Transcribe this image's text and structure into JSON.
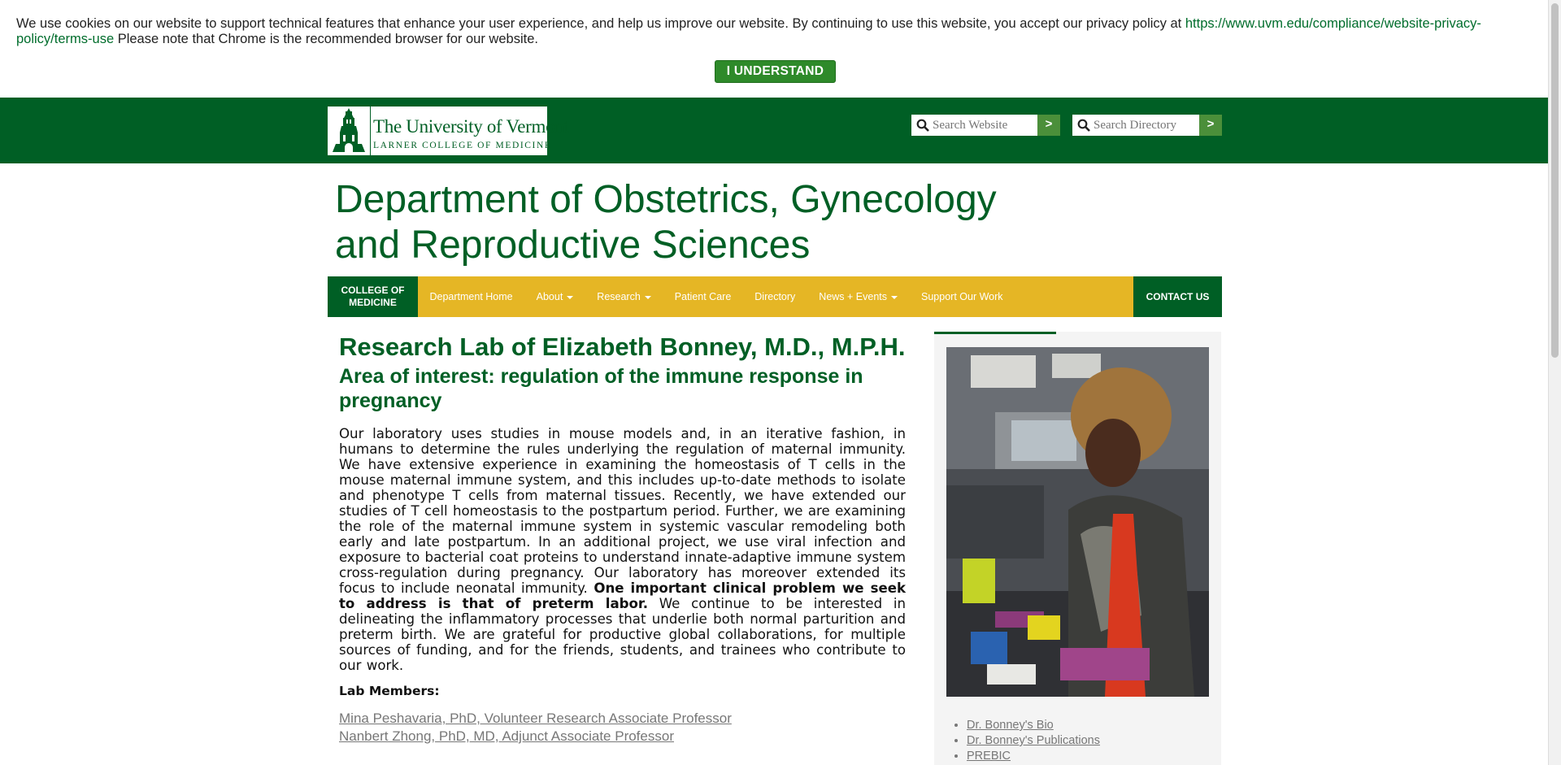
{
  "cookie": {
    "text": "We use cookies on our website to support technical features that enhance your user experience, and help us improve our website. By continuing to use this website, you accept our privacy policy at ",
    "link": "https://www.uvm.edu/compliance/website-privacy-policy/terms-use",
    "text_after": " Please note that Chrome is the recommended browser for our website.",
    "button": "I UNDERSTAND"
  },
  "header": {
    "logo_title": "The University of Vermont",
    "logo_subtitle": "LARNER COLLEGE OF MEDICINE",
    "search_website_placeholder": "Search Website",
    "search_directory_placeholder": "Search Directory",
    "go_label": ">"
  },
  "department_title": "Department of Obstetrics, Gynecology and Reproductive Sciences",
  "nav": {
    "college": "COLLEGE OF MEDICINE",
    "items": [
      {
        "label": "Department Home"
      },
      {
        "label": "About"
      },
      {
        "label": "Research"
      },
      {
        "label": "Patient Care"
      },
      {
        "label": "Directory"
      },
      {
        "label": "News + Events"
      },
      {
        "label": "Support Our Work"
      }
    ],
    "contact": "CONTACT US"
  },
  "main": {
    "title": "Research Lab of Elizabeth Bonney, M.D., M.P.H.",
    "subtitle": "Area of interest: regulation of the immune response in pregnancy",
    "body_part1": "Our laboratory uses studies in mouse models and, in an iterative fashion, in humans to determine the rules underlying the regulation of maternal immunity. We have extensive experience in examining the homeostasis of T cells in the mouse maternal immune system, and this includes up-to-date methods to isolate and phenotype T cells from maternal tissues. Recently, we have extended our studies of T cell homeostasis to the postpartum period. Further, we are examining the role of the maternal immune system in systemic vascular remodeling both early and late postpartum. In an additional project, we use viral infection and exposure to bacterial coat proteins to understand innate-adaptive immune system cross-regulation during pregnancy. Our laboratory has moreover extended its focus to include neonatal immunity. ",
    "body_bold": "One important clinical problem we seek to address is that of preterm labor.",
    "body_part2": " We continue to be interested in delineating the inflammatory processes that underlie both normal parturition and preterm birth. We are grateful for productive global collaborations, for multiple sources of funding, and for the friends, students, and trainees who contribute to our work.",
    "members_label": "Lab Members:",
    "members": [
      "Mina Peshavaria, PhD, Volunteer Research Associate Professor",
      "Nanbert Zhong, PhD, MD, Adjunct Associate Professor"
    ]
  },
  "sidebar": {
    "links": [
      "Dr. Bonney's Bio",
      "Dr. Bonney's Publications",
      "PREBIC"
    ]
  }
}
